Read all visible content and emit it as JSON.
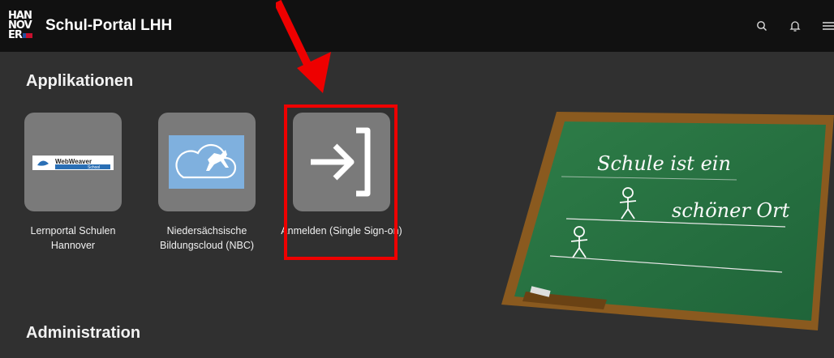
{
  "header": {
    "logo_text": [
      "HAN",
      "NOV",
      "ER"
    ],
    "title": "Schul-Portal LHH",
    "icons": [
      "search-icon",
      "bell-icon",
      "menu-icon"
    ]
  },
  "sections": {
    "applications": "Applikationen",
    "administration": "Administration"
  },
  "apps": [
    {
      "label": "Lernportal Schulen Hannover",
      "logo_text": "WebWeaver",
      "logo_sub": "School"
    },
    {
      "label": "Niedersächsische Bildungscloud (NBC)"
    },
    {
      "label": "Anmelden (Single Sign-on)"
    }
  ],
  "chalkboard": {
    "line1": "Schule ist ein",
    "line2": "schöner Ort"
  },
  "colors": {
    "highlight": "#e00000",
    "tile": "#7a7a7a",
    "header": "#111111"
  }
}
